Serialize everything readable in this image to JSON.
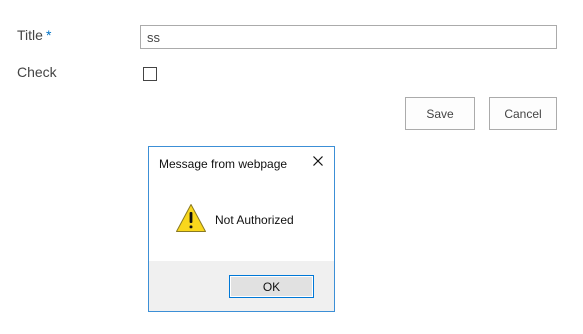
{
  "form": {
    "title_label": "Title",
    "required_marker": "*",
    "title_value": "ss",
    "check_label": "Check",
    "check_checked": false,
    "save_label": "Save",
    "cancel_label": "Cancel"
  },
  "dialog": {
    "title": "Message from webpage",
    "close_icon": "close-icon",
    "icon": "warning-icon",
    "message": "Not Authorized",
    "ok_label": "OK"
  },
  "colors": {
    "required": "#0072c6",
    "dialog_border": "#3c8fd6",
    "warning_fill": "#f9d71c",
    "ok_border": "#0078d7"
  }
}
